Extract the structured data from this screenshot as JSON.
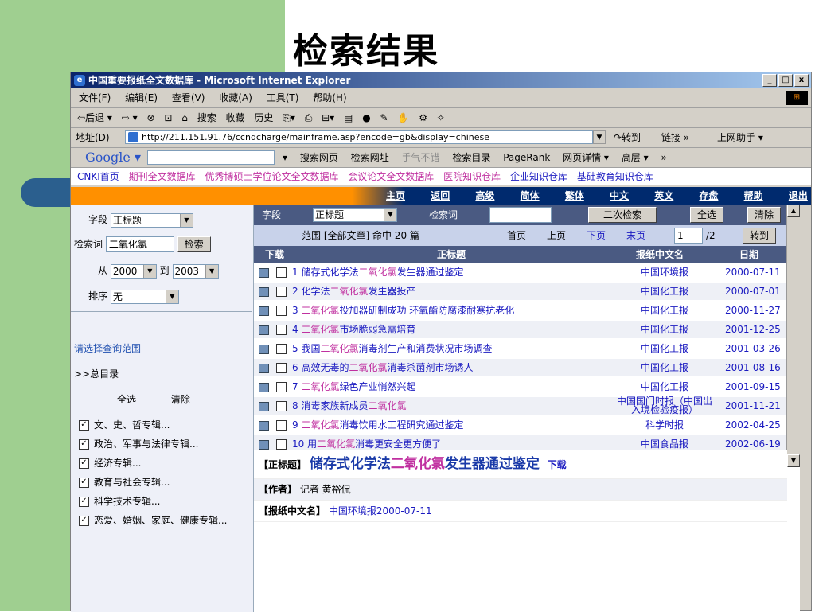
{
  "slide": {
    "title": "检索结果"
  },
  "window": {
    "title": "中国重要报纸全文数据库 - Microsoft Internet Explorer",
    "min": "_",
    "max": "□",
    "close": "x"
  },
  "menu": [
    "文件(F)",
    "编辑(E)",
    "查看(V)",
    "收藏(A)",
    "工具(T)",
    "帮助(H)"
  ],
  "toolbar": [
    "⇦后退 ▾",
    "⇨ ▾",
    "⊗",
    "⊡",
    "⌂",
    "搜索",
    "收藏",
    "历史",
    "⎘▾",
    "⎙",
    "⊟▾",
    "▤",
    "●",
    "✎",
    "✋",
    "⚙",
    "✧"
  ],
  "address": {
    "label": "地址(D)",
    "url": "http://211.151.91.76/ccndcharge/mainframe.asp?encode=gb&display=chinese",
    "go": "↷转到",
    "links": "链接 »",
    "helper": "上网助手 ▾"
  },
  "google": {
    "logo": "Google ▾",
    "items": [
      "▾",
      "搜索网页",
      "检索网址",
      "手气不错",
      "检索目录",
      "PageRank",
      "网页详情 ▾",
      "高层 ▾",
      "»"
    ]
  },
  "nav": [
    {
      "label": "CNKI首页",
      "pink": false
    },
    {
      "label": "期刊全文数据库",
      "pink": true
    },
    {
      "label": "优秀博硕士学位论文全文数据库",
      "pink": true
    },
    {
      "label": "会议论文全文数据库",
      "pink": true
    },
    {
      "label": "医院知识仓库",
      "pink": true
    },
    {
      "label": "企业知识仓库",
      "pink": false
    },
    {
      "label": "基础教育知识仓库",
      "pink": false
    }
  ],
  "topmenu": [
    "主页",
    "返回",
    "高级",
    "简体",
    "繁体",
    "中文",
    "英文",
    "存盘",
    "帮助",
    "退出"
  ],
  "left": {
    "field_label": "字段",
    "field_value": "正标题",
    "keyword_label": "检索词",
    "keyword_value": "二氧化氯",
    "search_btn": "检索",
    "from_label": "从",
    "from_value": "2000",
    "to_label": "到",
    "to_value": "2003",
    "sort_label": "排序",
    "sort_value": "无",
    "range_prompt": "请选择查询范围",
    "catalog": ">>总目录",
    "select_all": "全选",
    "clear": "清除",
    "categories": [
      "文、史、哲专辑...",
      "政治、军事与法律专辑...",
      "经济专辑...",
      "教育与社会专辑...",
      "科学技术专辑...",
      "恋爱、婚姻、家庭、健康专辑..."
    ]
  },
  "right": {
    "field_label": "字段",
    "field_value": "正标题",
    "keyword_label": "检索词",
    "keyword_value": "",
    "secondary_btn": "二次检索",
    "select_all_btn": "全选",
    "clear_btn": "清除",
    "range_text": "范围 [全部文章] 命中 20 篇",
    "first": "首页",
    "prev": "上页",
    "next": "下页",
    "last": "末页",
    "page_value": "1",
    "page_total": "/2",
    "goto_btn": "转到",
    "headers": {
      "download": "下载",
      "title": "正标题",
      "paper": "报纸中文名",
      "date": "日期"
    },
    "rows": [
      {
        "no": "1",
        "pre": "储存式化学法",
        "kw": "二氧化氯",
        "post": "发生器通过鉴定",
        "paper": "中国环境报",
        "date": "2000-07-11"
      },
      {
        "no": "2",
        "pre": "化学法",
        "kw": "二氧化氯",
        "post": "发生器投产",
        "paper": "中国化工报",
        "date": "2000-07-01"
      },
      {
        "no": "3",
        "pre": "",
        "kw": "二氧化氯",
        "post": "投加器研制成功 环氧酯防腐漆耐寒抗老化",
        "paper": "中国化工报",
        "date": "2000-11-27"
      },
      {
        "no": "4",
        "pre": "",
        "kw": "二氧化氯",
        "post": "市场脆弱急需培育",
        "paper": "中国化工报",
        "date": "2001-12-25"
      },
      {
        "no": "5",
        "pre": "我国",
        "kw": "二氧化氯",
        "post": "消毒剂生产和消费状况市场调查",
        "paper": "中国化工报",
        "date": "2001-03-26"
      },
      {
        "no": "6",
        "pre": "高效无毒的",
        "kw": "二氧化氯",
        "post": "消毒杀菌剂市场诱人",
        "paper": "中国化工报",
        "date": "2001-08-16"
      },
      {
        "no": "7",
        "pre": "",
        "kw": "二氧化氯",
        "post": "绿色产业悄然兴起",
        "paper": "中国化工报",
        "date": "2001-09-15"
      },
      {
        "no": "8",
        "pre": "消毒家族新成员",
        "kw": "二氧化氯",
        "post": "",
        "paper": "中国国门时报（中国出入境检验疫报）",
        "date": "2001-11-21"
      },
      {
        "no": "9",
        "pre": "",
        "kw": "二氧化氯",
        "post": "消毒饮用水工程研究通过鉴定",
        "paper": "科学时报",
        "date": "2002-04-25"
      },
      {
        "no": "10",
        "pre": "用",
        "kw": "二氧化氯",
        "post": "消毒更安全更方便了",
        "paper": "中国食品报",
        "date": "2002-06-19"
      }
    ],
    "detail": {
      "title_label": "【正标题】",
      "title_pre": "储存式化学法",
      "title_kw": "二氧化氯",
      "title_post": "发生器通过鉴定",
      "download": "下载",
      "author_label": "【作者】",
      "author": "记者 黄裕侃",
      "paper_label": "【报纸中文名】",
      "paper": "中国环境报2000-07-11"
    }
  }
}
